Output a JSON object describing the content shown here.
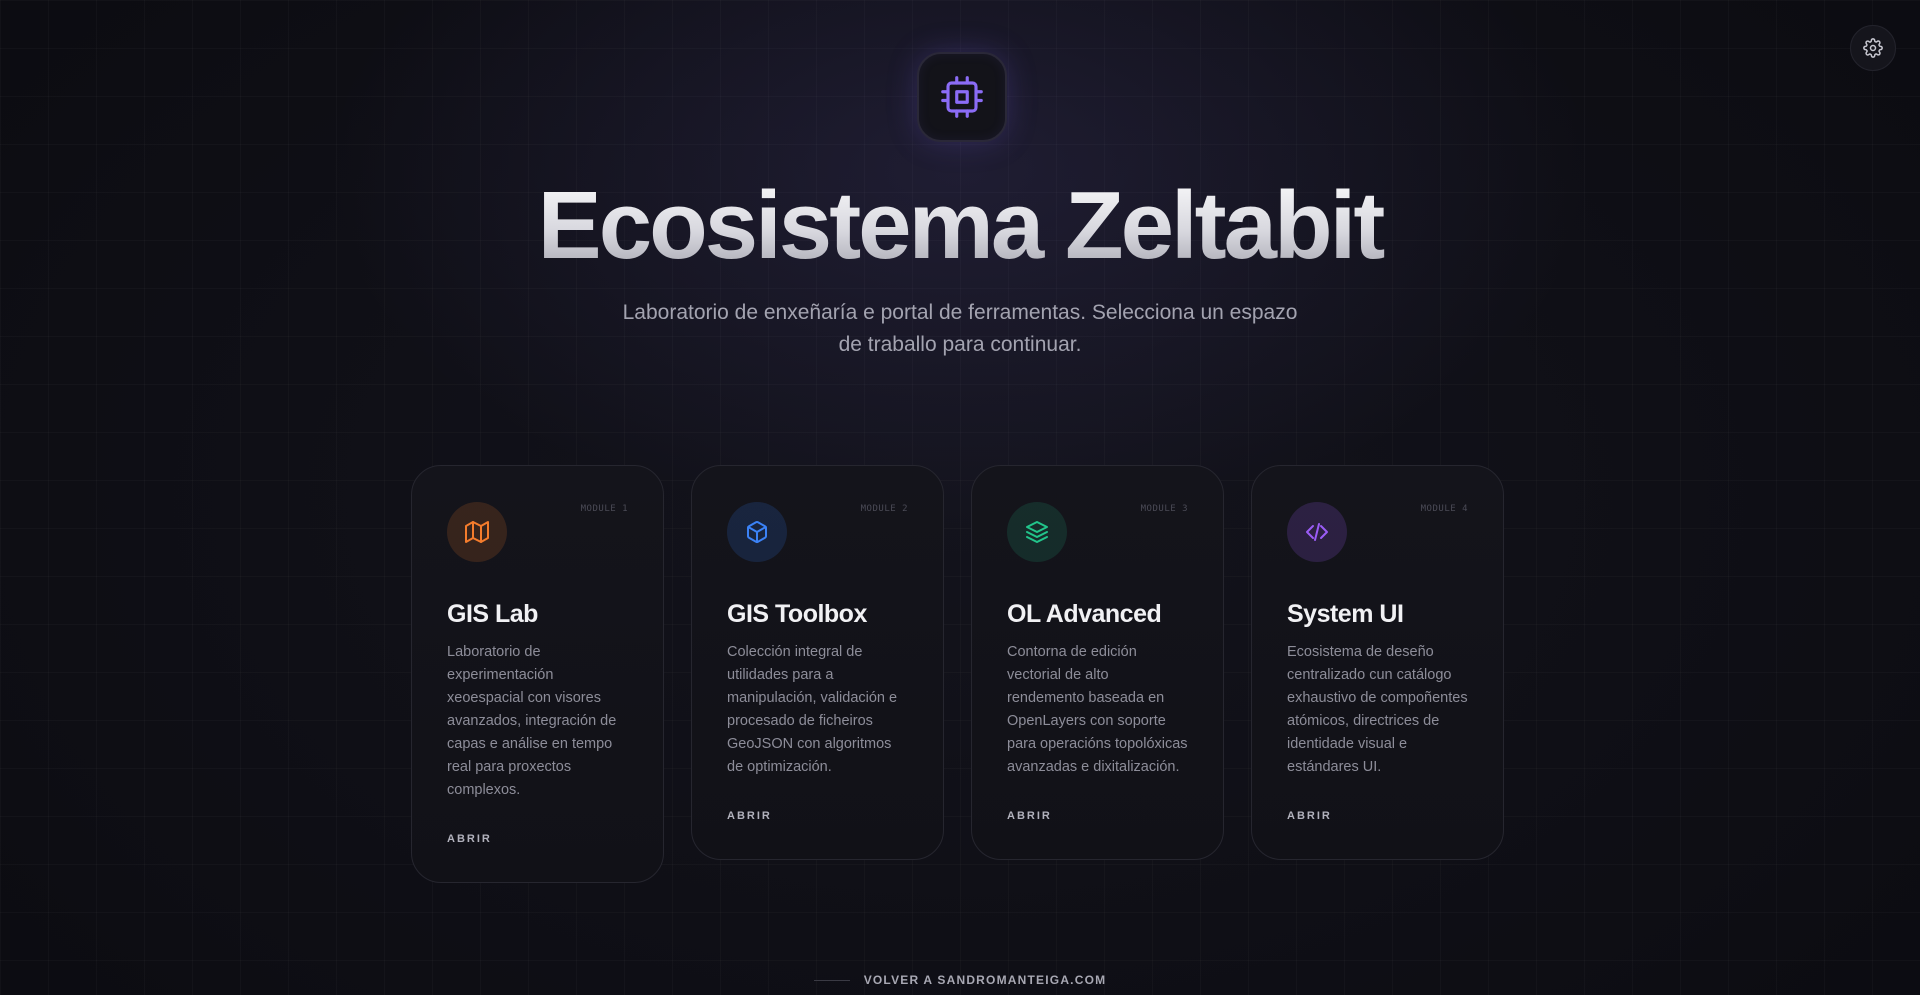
{
  "settings": {
    "icon": "gear-icon"
  },
  "hero": {
    "logo_icon": "cpu-chip-icon",
    "title": "Ecosistema Zeltabit",
    "subtitle": "Laboratorio de enxeñaría e portal de ferramentas. Selecciona un espazo de traballo para continuar.",
    "accent_color": "#8b6cf6"
  },
  "cards": [
    {
      "module": "MODULE 1",
      "icon": "map-icon",
      "icon_color": "#f47c2c",
      "title": "GIS Lab",
      "description": "Laboratorio de experimentación xeoespacial con visores avanzados, integración de capas e análise en tempo real para proxectos complexos.",
      "action": "ABRIR"
    },
    {
      "module": "MODULE 2",
      "icon": "cube-icon",
      "icon_color": "#3b82f6",
      "title": "GIS Toolbox",
      "description": "Colección integral de utilidades para a manipulación, validación e procesado de ficheiros GeoJSON con algoritmos de optimización.",
      "action": "ABRIR"
    },
    {
      "module": "MODULE 3",
      "icon": "layers-icon",
      "icon_color": "#22c58b",
      "title": "OL Advanced",
      "description": "Contorna de edición vectorial de alto rendemento baseada en OpenLayers con soporte para operacións topolóxicas avanzadas e dixitalización.",
      "action": "ABRIR"
    },
    {
      "module": "MODULE 4",
      "icon": "code-icon",
      "icon_color": "#9b5cf6",
      "title": "System UI",
      "description": "Ecosistema de deseño centralizado cun catálogo exhaustivo de compoñentes atómicos, directrices de identidade visual e estándares UI.",
      "action": "ABRIR"
    }
  ],
  "footer": {
    "link_text": "VOLVER A SANDROMANTEIGA.COM"
  }
}
